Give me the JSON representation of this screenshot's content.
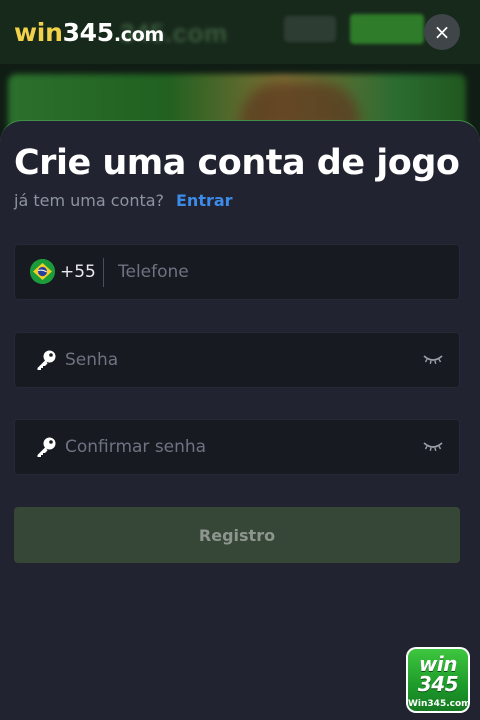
{
  "header": {
    "logo": {
      "prefix": "win",
      "number": "345",
      "domain": ".com"
    },
    "close_icon": "×"
  },
  "signup": {
    "title": "Crie uma conta de jogo",
    "have_account_text": "já tem uma conta?",
    "login_link": "Entrar",
    "phone": {
      "country_code": "+55",
      "placeholder": "Telefone",
      "flag": "brazil-flag-icon"
    },
    "password": {
      "placeholder": "Senha"
    },
    "confirm_password": {
      "placeholder": "Confirmar senha"
    },
    "register_label": "Registro"
  },
  "badge": {
    "line1": "win",
    "line2": "345",
    "line3": "Win345.com"
  },
  "colors": {
    "sheet_bg": "#212430",
    "field_bg": "#181a22",
    "link": "#3d8be8",
    "button_disabled": "#364637",
    "logo_gold": "#f2d14b"
  }
}
